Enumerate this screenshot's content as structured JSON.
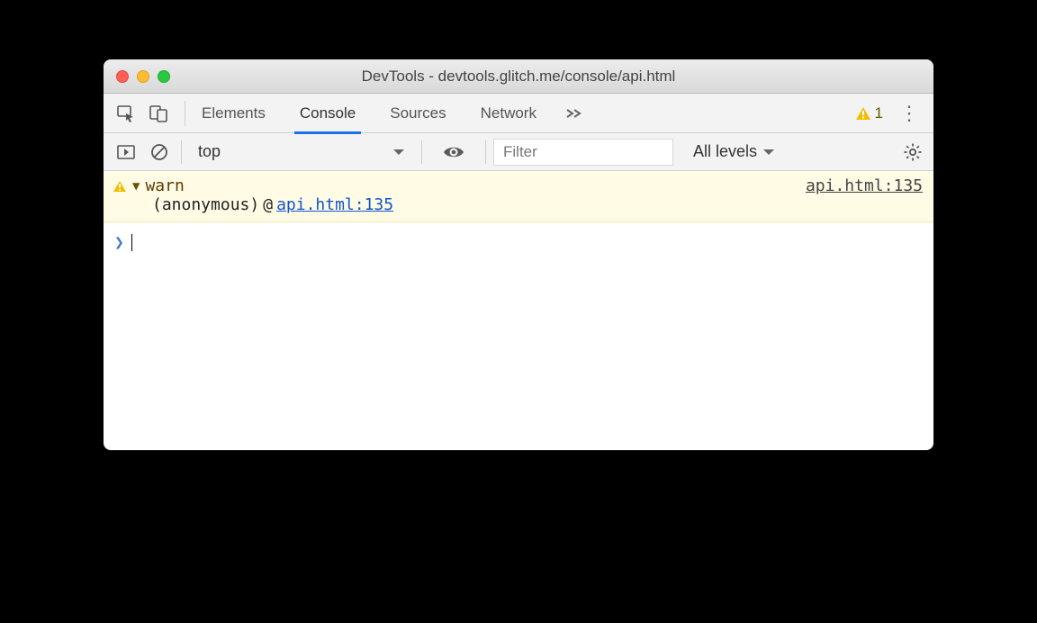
{
  "window": {
    "title": "DevTools - devtools.glitch.me/console/api.html"
  },
  "tabs": {
    "elements": "Elements",
    "console": "Console",
    "sources": "Sources",
    "network": "Network"
  },
  "badge": {
    "warning_count": "1"
  },
  "filter": {
    "context": "top",
    "placeholder": "Filter",
    "levels": "All levels"
  },
  "log": {
    "warn_label": "warn",
    "source_link": "api.html:135",
    "anon": "(anonymous)",
    "at": "@",
    "trace_link": "api.html:135"
  }
}
